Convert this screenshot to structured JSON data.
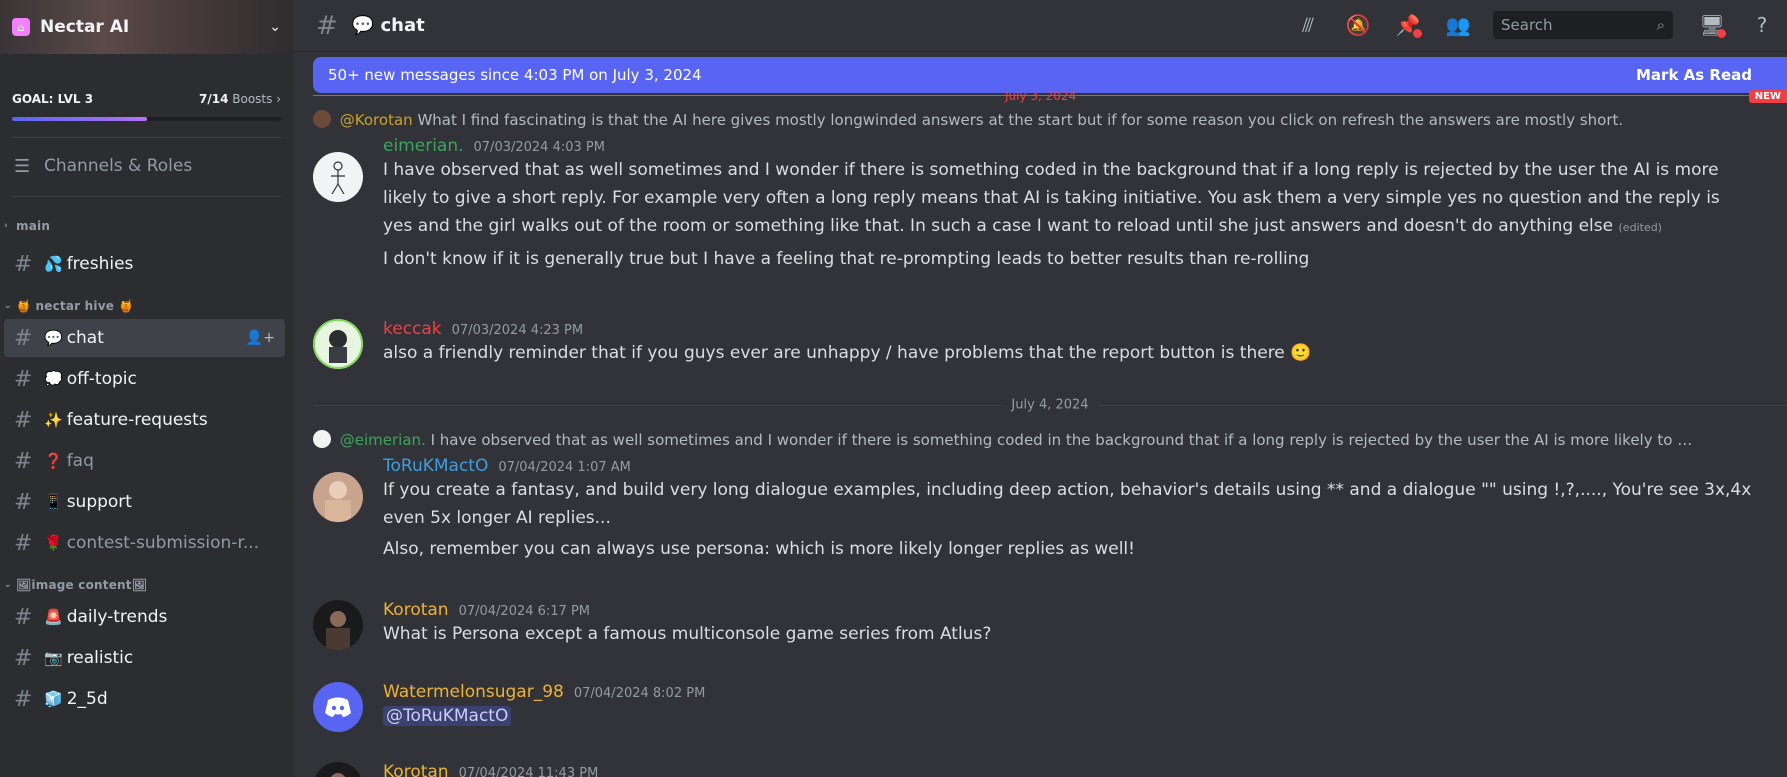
{
  "server": {
    "name": "Nectar AI"
  },
  "goal": {
    "title": "GOAL: LVL 3",
    "count": "7/14",
    "count_suffix": "Boosts",
    "progress": 0.5
  },
  "nav": {
    "channels_roles": "Channels & Roles"
  },
  "categories": [
    {
      "name": "main",
      "channels": [
        {
          "emoji": "💦",
          "name": "freshies"
        }
      ]
    },
    {
      "name": "🍯 nectar hive 🍯",
      "channels": [
        {
          "emoji": "💬",
          "name": "chat"
        },
        {
          "emoji": "💭",
          "name": "off-topic"
        },
        {
          "emoji": "✨",
          "name": "feature-requests"
        },
        {
          "emoji": "❓",
          "name": "faq"
        },
        {
          "emoji": "📱",
          "name": "support"
        },
        {
          "emoji": "🌹",
          "name": "contest-submission-r..."
        }
      ]
    },
    {
      "name": "🖼image content🖼",
      "channels": [
        {
          "emoji": "🚨",
          "name": "daily-trends"
        },
        {
          "emoji": "📷",
          "name": "realistic"
        },
        {
          "emoji": "🧊",
          "name": "2_5d"
        }
      ]
    }
  ],
  "topbar": {
    "channel": "💬 chat",
    "search_placeholder": "Search"
  },
  "banner": {
    "text": "50+ new messages since 4:03 PM on July 3, 2024",
    "action": "Mark As Read",
    "new_tag": "NEW",
    "date": "July 3, 2024"
  },
  "messages": [
    {
      "reply_name": "@Korotan",
      "reply_text": "What I find fascinating is that the AI here gives mostly longwinded answers at the start but if for some reason you click on refresh the answers are mostly short.",
      "author": "eimerian.",
      "author_color": "#3ba55c",
      "time": "07/03/2024 4:03 PM",
      "text": "I have observed that as well sometimes and I wonder if there is something coded in the background that if a long reply is rejected by the user the AI is more likely to give a short reply. For example very often a long reply means that AI is taking initiative. You ask them a very simple yes no question and the reply is yes and the girl walks out of the room or something like that. In such a case I want to reload until she just answers and doesn't do anything else",
      "edited": "(edited)",
      "text2": "I don't know if it is generally true but I have a feeling that re-prompting leads to better results than re-rolling"
    },
    {
      "author": "keccak",
      "author_color": "#f23f43",
      "time": "07/03/2024 4:23 PM",
      "text": "also a friendly reminder that if you guys ever are unhappy / have problems that the report button is there 🙂"
    },
    {
      "divider": "July 4, 2024"
    },
    {
      "reply_name": "@eimerian.",
      "reply_text": "I have observed that as well sometimes and I wonder if there is something coded in the background that if a long reply is rejected by the user the AI is more likely to gi...",
      "author": "ToRuKMactO",
      "author_color": "#3d9fe0",
      "time": "07/04/2024 1:07 AM",
      "text": "If you create a fantasy, and build very long dialogue examples, including deep action, behavior's details using ** and a dialogue \"\" using !,?,...., You're see 3x,4x even 5x longer AI replies...",
      "text2": "Also, remember you can always use persona: which is more likely longer replies as well!"
    },
    {
      "author": "Korotan",
      "author_color": "#f0b232",
      "time": "07/04/2024 6:17 PM",
      "text": "What is Persona except a famous multiconsole game series from Atlus?"
    },
    {
      "author": "Watermelonsugar_98",
      "author_color": "#f0b232",
      "time": "07/04/2024 8:02 PM",
      "text": "@ToRuKMactO"
    },
    {
      "author": "Korotan",
      "author_color": "#f0b232",
      "time": "07/04/2024 11:43 PM"
    }
  ]
}
